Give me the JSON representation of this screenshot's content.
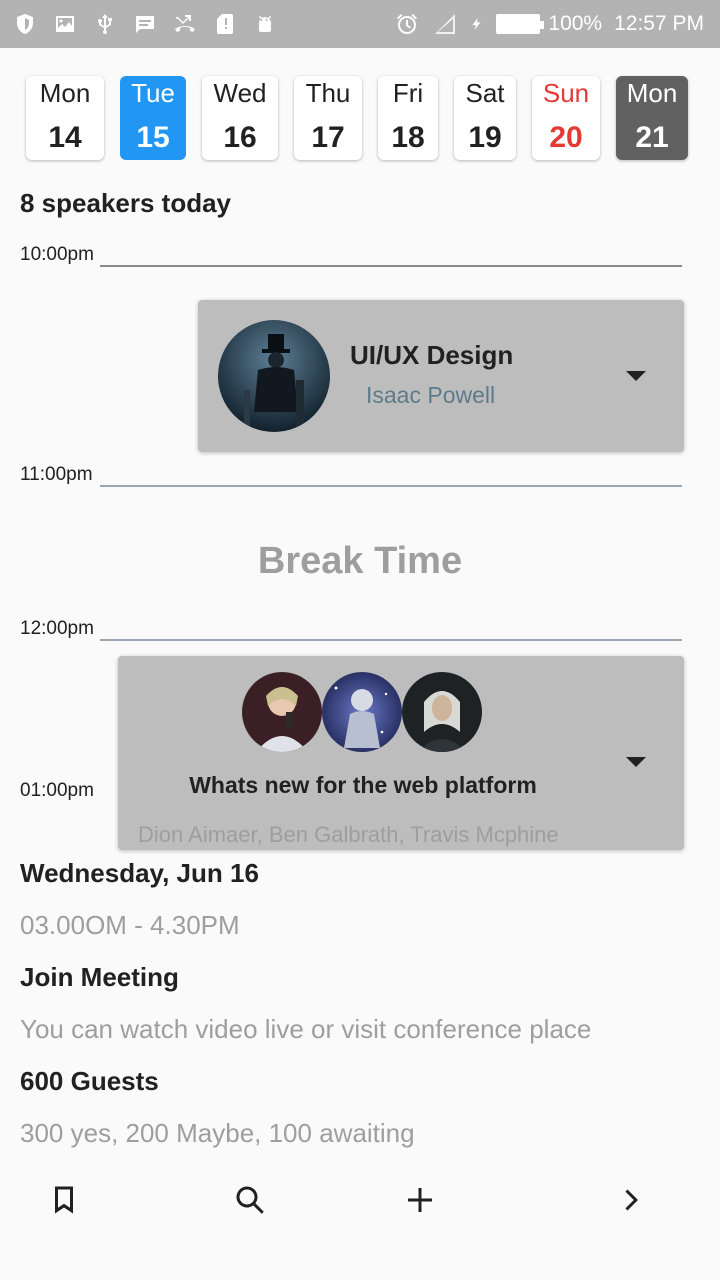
{
  "status_bar": {
    "battery_percent": "100%",
    "time": "12:57 PM",
    "left_icons": [
      "shield-icon",
      "image-icon",
      "usb-icon",
      "message-icon",
      "missed-call-icon",
      "sd-card-icon",
      "android-icon"
    ],
    "right_icons": [
      "alarm-icon",
      "signal-icon",
      "charging-icon",
      "battery-icon"
    ]
  },
  "days": [
    {
      "name": "Mon",
      "date": "14",
      "state": "normal"
    },
    {
      "name": "Tue",
      "date": "15",
      "state": "selected"
    },
    {
      "name": "Wed",
      "date": "16",
      "state": "normal"
    },
    {
      "name": "Thu",
      "date": "17",
      "state": "normal"
    },
    {
      "name": "Fri",
      "date": "18",
      "state": "normal"
    },
    {
      "name": "Sat",
      "date": "19",
      "state": "normal"
    },
    {
      "name": "Sun",
      "date": "20",
      "state": "sunday"
    },
    {
      "name": "Mon",
      "date": "21",
      "state": "dark"
    }
  ],
  "speakers_today": "8 speakers today",
  "timeline": {
    "t1": "10:00pm",
    "t2": "11:00pm",
    "t3": "12:00pm",
    "t4": "01:00pm"
  },
  "session1": {
    "title": "UI/UX Design",
    "speaker": "Isaac Powell"
  },
  "break_label": "Break Time",
  "session2": {
    "title": "Whats new for the web platform",
    "speakers": "Dion Aimaer, Ben Galbrath, Travis Mcphine"
  },
  "details": {
    "date": "Wednesday, Jun 16",
    "time": "03.00OM - 4.30PM",
    "meeting_title": "Join Meeting",
    "meeting_desc": "You can watch video live or visit conference place",
    "guests_title": "600 Guests",
    "guests_desc": "300 yes, 200 Maybe, 100 awaiting"
  },
  "bottom_bar": [
    "bookmark-icon",
    "search-icon",
    "add-icon",
    "chevron-right-icon"
  ],
  "colors": {
    "accent": "#2196f3",
    "sunday": "#e53935",
    "dark_day": "#616161",
    "card_bg": "#bdbdbd",
    "status_bar": "#b3b3b3"
  }
}
